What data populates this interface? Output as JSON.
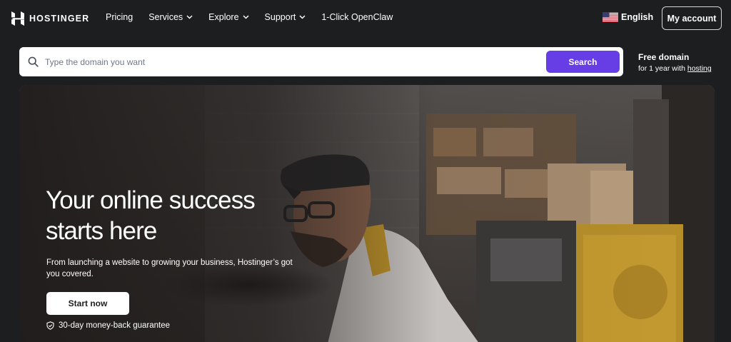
{
  "header": {
    "logo_text": "HOSTINGER",
    "nav": [
      {
        "label": "Pricing",
        "has_dropdown": false
      },
      {
        "label": "Services",
        "has_dropdown": true
      },
      {
        "label": "Explore",
        "has_dropdown": true
      },
      {
        "label": "Support",
        "has_dropdown": true
      },
      {
        "label": "1-Click OpenClaw",
        "has_dropdown": false
      }
    ],
    "language": {
      "label": "English",
      "flag_icon": "us-flag-icon"
    },
    "account_label": "My account"
  },
  "search": {
    "placeholder": "Type the domain you want",
    "value": "",
    "button_label": "Search"
  },
  "free_domain": {
    "title": "Free domain",
    "subtitle_prefix": "for 1 year with ",
    "subtitle_link": "hosting"
  },
  "hero": {
    "title": "Your online success starts here",
    "subtitle": "From launching a website to growing your business, Hostinger’s got you covered.",
    "cta_label": "Start now",
    "guarantee": "30-day money-back guarantee"
  },
  "colors": {
    "page_bg": "#1d1e20",
    "accent": "#673de6",
    "white": "#ffffff"
  }
}
